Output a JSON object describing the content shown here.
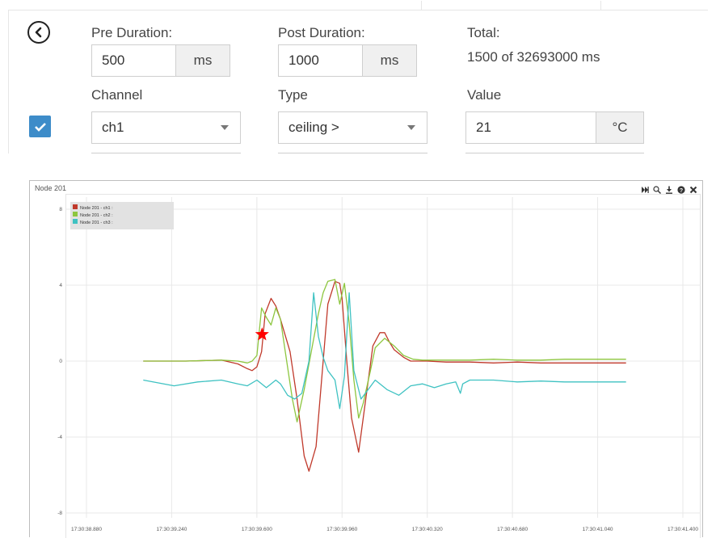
{
  "filters": {
    "pre_duration": {
      "label": "Pre Duration:",
      "value": "500",
      "unit": "ms"
    },
    "post_duration": {
      "label": "Post Duration:",
      "value": "1000",
      "unit": "ms"
    },
    "total": {
      "label": "Total:",
      "value": "1500 of 32693000 ms"
    },
    "channel": {
      "label": "Channel",
      "selected": "ch1"
    },
    "type": {
      "label": "Type",
      "selected": "ceiling >"
    },
    "value": {
      "label": "Value",
      "value": "21",
      "unit": "°C"
    },
    "enabled": true
  },
  "chart_panel": {
    "title": "Node 201"
  },
  "chart_data": {
    "type": "line",
    "title": "",
    "xlabel": "",
    "ylabel": "",
    "x_ticks": [
      "17:30:38.880",
      "17:30:39.240",
      "17:30:39.600",
      "17:30:39.960",
      "17:30:40.320",
      "17:30:40.680",
      "17:30:41.040",
      "17:30:41.400"
    ],
    "y_ticks": [
      8,
      4,
      0,
      -4,
      -8
    ],
    "ylim": [
      -8,
      8
    ],
    "xlim_seconds_after_17_30_38": [
      0.88,
      41.4
    ],
    "legend_placement": "top-left",
    "grid": true,
    "marker": {
      "shape": "star",
      "color": "#ff0000",
      "x": "17:30:39.622",
      "y": 1.4
    },
    "series": [
      {
        "name": "Node 201 - ch1 :",
        "color": "#c0392b",
        "x": [
          39.12,
          39.3,
          39.45,
          39.52,
          39.56,
          39.58,
          39.6,
          39.62,
          39.635,
          39.66,
          39.68,
          39.7,
          39.74,
          39.77,
          39.8,
          39.82,
          39.85,
          39.88,
          39.9,
          39.93,
          39.95,
          39.96,
          39.98,
          40.0,
          40.03,
          40.06,
          40.09,
          40.12,
          40.14,
          40.16,
          40.18,
          40.22,
          40.25,
          40.28,
          40.32,
          40.4,
          40.5,
          40.6,
          40.7,
          40.8,
          40.9,
          41.0,
          41.16
        ],
        "y": [
          0.0,
          0.0,
          0.05,
          -0.15,
          -0.4,
          -0.5,
          -0.3,
          0.5,
          2.5,
          3.3,
          2.9,
          2.2,
          0.5,
          -2.0,
          -5.0,
          -5.8,
          -4.5,
          0.0,
          3.0,
          4.2,
          4.1,
          3.3,
          0.0,
          -3.0,
          -4.8,
          -2.0,
          0.8,
          1.5,
          1.5,
          1.0,
          0.6,
          0.2,
          0.0,
          0.0,
          0.0,
          -0.05,
          -0.05,
          -0.1,
          -0.05,
          -0.1,
          -0.1,
          -0.1,
          -0.1
        ]
      },
      {
        "name": "Node 201 - ch2 :",
        "color": "#8dc63f",
        "x": [
          39.12,
          39.3,
          39.45,
          39.52,
          39.56,
          39.58,
          39.6,
          39.62,
          39.64,
          39.66,
          39.68,
          39.7,
          39.72,
          39.75,
          39.77,
          39.8,
          39.83,
          39.86,
          39.88,
          39.9,
          39.93,
          39.95,
          39.97,
          39.99,
          40.01,
          40.03,
          40.05,
          40.08,
          40.1,
          40.14,
          40.18,
          40.22,
          40.26,
          40.3,
          40.4,
          40.5,
          40.6,
          40.7,
          40.8,
          40.9,
          41.0,
          41.16
        ],
        "y": [
          0.0,
          0.0,
          0.05,
          0.0,
          -0.1,
          0.0,
          0.3,
          2.8,
          2.3,
          1.9,
          2.8,
          2.2,
          0.5,
          -2.0,
          -3.2,
          -1.5,
          0.5,
          2.5,
          3.6,
          4.2,
          4.3,
          3.0,
          4.1,
          2.0,
          -1.0,
          -3.0,
          -2.2,
          -0.5,
          0.7,
          1.2,
          0.8,
          0.3,
          0.1,
          0.05,
          0.05,
          0.05,
          0.1,
          0.05,
          0.05,
          0.1,
          0.1,
          0.1
        ]
      },
      {
        "name": "Node 201 - ch3 :",
        "color": "#3fc2c2",
        "x": [
          39.12,
          39.25,
          39.35,
          39.45,
          39.52,
          39.56,
          39.6,
          39.64,
          39.66,
          39.68,
          39.7,
          39.73,
          39.76,
          39.79,
          39.82,
          39.84,
          39.86,
          39.88,
          39.9,
          39.93,
          39.95,
          39.97,
          39.99,
          40.01,
          40.04,
          40.07,
          40.1,
          40.15,
          40.2,
          40.25,
          40.3,
          40.35,
          40.4,
          40.44,
          40.46,
          40.47,
          40.5,
          40.6,
          40.7,
          40.8,
          40.9,
          41.0,
          41.16
        ],
        "y": [
          -1.0,
          -1.3,
          -1.1,
          -1.0,
          -1.2,
          -1.3,
          -1.0,
          -1.4,
          -1.2,
          -1.0,
          -1.2,
          -1.8,
          -2.0,
          -1.7,
          0.0,
          3.6,
          1.3,
          0.2,
          -0.5,
          -1.0,
          -2.5,
          -0.8,
          3.6,
          -0.5,
          -2.0,
          -1.5,
          -1.0,
          -1.5,
          -1.8,
          -1.3,
          -1.2,
          -1.4,
          -1.2,
          -1.1,
          -1.7,
          -1.2,
          -1.0,
          -1.0,
          -1.1,
          -1.05,
          -1.1,
          -1.1,
          -1.1
        ]
      }
    ]
  },
  "icons": {
    "back": "chevron-left-circle-icon",
    "checkbox": "checkmark-icon",
    "tools": [
      "skip-end-icon",
      "zoom-icon",
      "download-icon",
      "help-icon",
      "close-icon"
    ]
  }
}
